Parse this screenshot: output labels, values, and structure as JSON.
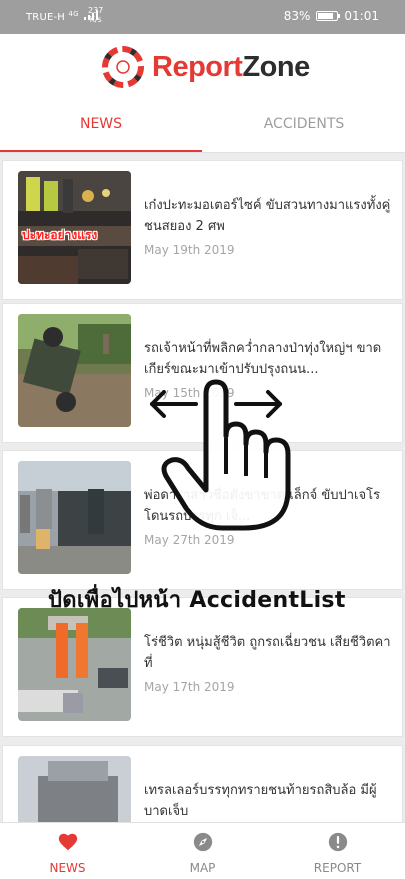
{
  "status_bar": {
    "carrier": "TRUE-H",
    "network_type": "4G",
    "speed_value": "237",
    "speed_unit": "K/s",
    "battery": "83%",
    "battery_level": 0.83,
    "time": "01:01"
  },
  "header": {
    "logo_text_1": "Report",
    "logo_text_2": "Zone"
  },
  "tabs": [
    {
      "label": "NEWS",
      "active": true
    },
    {
      "label": "ACCIDENTS",
      "active": false
    }
  ],
  "news": [
    {
      "title": "เก๋งปะทะมอเตอร์ไซค์ ขับสวนทางมาแรงทั้งคู่ ชนสยอง 2 ศพ",
      "date": "May 19th 2019",
      "thumb_caption": "ปะทะอย่างแรง"
    },
    {
      "title": "รถเจ้าหน้าที่พลิกคว่ำกลางป่าทุ่งใหญ่ฯ ขาดเกียร์ขณะมาเข้าปรับปรุงถนน...",
      "date": "May 15th 2019"
    },
    {
      "title": "พ่อดาราสาวชื่อดังขาขาด เล็กจ์ ขับปาเจโรโดนรถบรรทุก เจ็...",
      "date": "May 27th 2019"
    },
    {
      "title": "โร่ชีวิต หนุ่มสู้ชีวิต ถูกรถเฉี่ยวชน เสียชีวิตคาที่",
      "date": "May 17th 2019"
    },
    {
      "title": "เทรลเลอร์บรรทุกทรายชนท้ายรถสิบล้อ มีผู้บาดเจ็บ",
      "date": ""
    }
  ],
  "overlay": {
    "hint_text": "ปัดเพื่อไปหน้า AccidentList"
  },
  "bottom_nav": [
    {
      "label": "NEWS",
      "icon": "heart-icon",
      "active": true
    },
    {
      "label": "MAP",
      "icon": "compass-icon",
      "active": false
    },
    {
      "label": "REPORT",
      "icon": "alert-icon",
      "active": false
    }
  ],
  "colors": {
    "accent": "#e53935",
    "inactive": "#8a8a8a",
    "status_bar": "#9e9e9e"
  }
}
